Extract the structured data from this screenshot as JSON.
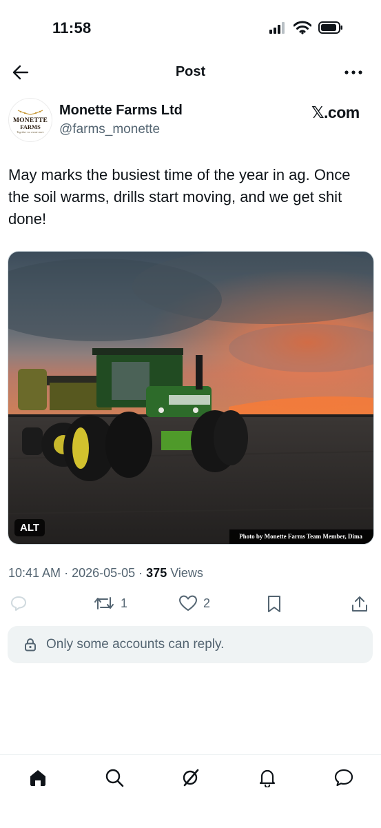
{
  "status_bar": {
    "time": "11:58"
  },
  "nav": {
    "title": "Post"
  },
  "author": {
    "avatar_logo": {
      "line1": "MONETTE",
      "line2": "FARMS",
      "tagline": "Together we create more"
    },
    "name": "Monette Farms Ltd",
    "handle": "@farms_monette"
  },
  "watermark": "𝕏.com",
  "post": {
    "text": "May marks the busiest time of the year in ag. Once the soil warms, drills start moving, and we get shit done!",
    "media": {
      "alt_label": "ALT",
      "photo_credit": "Photo by Monette Farms Team Member, Dima"
    },
    "time": "10:41 AM",
    "date": "2026-05-05",
    "views_count": "375",
    "views_label": "Views"
  },
  "actions": {
    "reply_count": "",
    "repost_count": "1",
    "like_count": "2"
  },
  "reply_restriction": "Only some accounts can reply.",
  "colors": {
    "text_primary": "#0f1419",
    "text_secondary": "#536471",
    "surface_muted": "#eff3f4",
    "reply_icon_disabled": "#cfd9de"
  },
  "icons": {
    "nav": [
      "back-arrow-icon",
      "more-icon"
    ],
    "actions": [
      "reply-icon",
      "repost-icon",
      "like-icon",
      "bookmark-icon",
      "share-icon"
    ],
    "tabs": [
      "home-icon",
      "search-icon",
      "grok-icon",
      "notifications-icon",
      "messages-icon"
    ]
  }
}
